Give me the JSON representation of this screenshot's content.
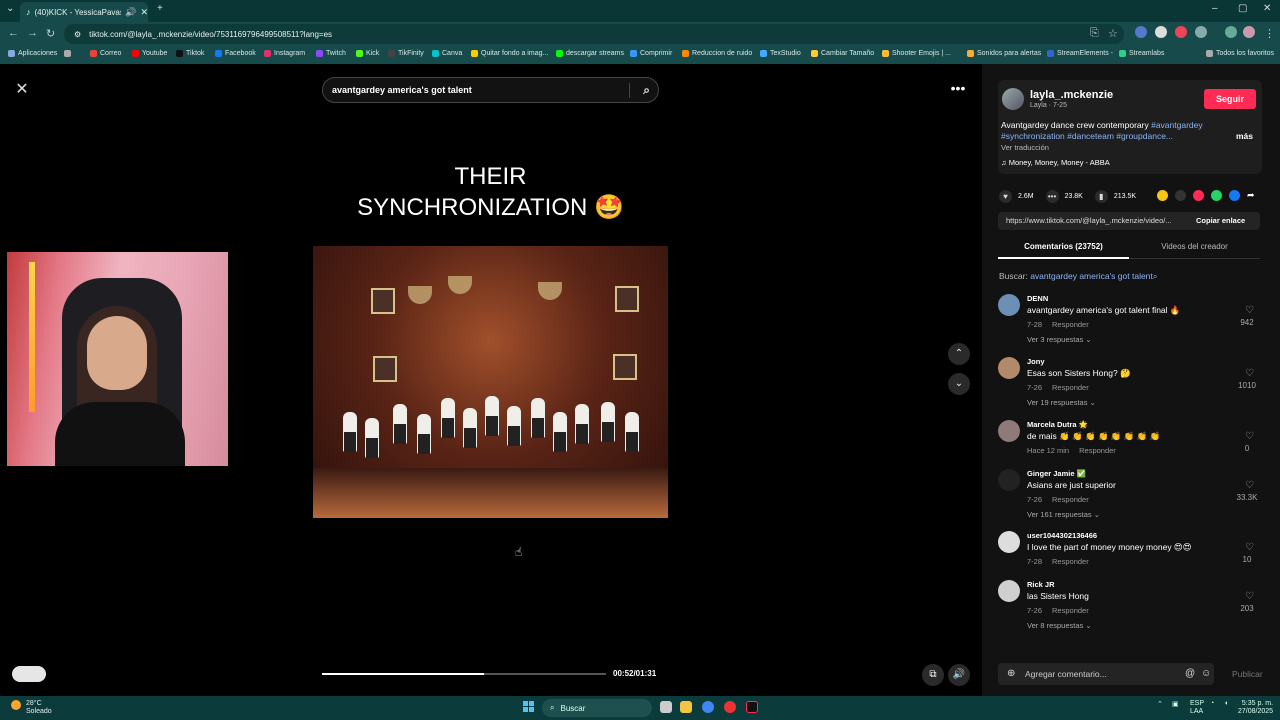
{
  "browser": {
    "tab_title": "(40)KICK - YessicaPavas",
    "url": "tiktok.com/@layla_.mckenzie/video/7531169796499508511?lang=es",
    "bookmarks": [
      "Aplicaciones",
      "Correo",
      "Youtube",
      "Tiktok",
      "Facebook",
      "Instagram",
      "Twitch",
      "Kick",
      "TikFinity",
      "Canva",
      "Quitar fondo a imag...",
      "descargar streams",
      "Comprimir",
      "Reduccion de ruido",
      "TexStudio",
      "Cambiar Tamaño",
      "Shooter Emojis | ...",
      "Sonidos para alertas",
      "StreamElements -",
      "Streamlabs",
      "Todos los favoritos"
    ]
  },
  "search": {
    "query": "avantgardey america's got talent"
  },
  "video": {
    "caption_line1": "THEIR",
    "caption_line2": "SYNCHRONIZATION 🤩",
    "time": "00:52/01:31",
    "progress": 0.57
  },
  "author": {
    "username": "layla_.mckenzie",
    "subline": "Layla · 7-25",
    "follow_label": "Seguir",
    "description_text": "Avantgardey dance crew contemporary ",
    "description_tags_1": "#avantgardey",
    "description_tags_2": "#synchronization #danceteam #groupdance...",
    "more_label": "más",
    "translate_label": "Ver traducción",
    "music": "Money, Money, Money - ABBA"
  },
  "stats": {
    "likes": "2.6M",
    "comments": "23.8K",
    "saves": "213.5K"
  },
  "link": {
    "url": "https://www.tiktok.com/@layla_.mckenzie/video/...",
    "copy_label": "Copiar enlace"
  },
  "tabs": {
    "comments": "Comentarios (23752)",
    "creator_videos": "Videos del creador"
  },
  "buscar": {
    "label": "Buscar: ",
    "query": "avantgardey america's got talent"
  },
  "comments": [
    {
      "name": "DENN",
      "text": "avantgardey america's got talent final 🔥",
      "date": "7-28",
      "reply": "Responder",
      "replies": "Ver 3 respuestas ⌄",
      "likes": "942",
      "avatar_color": "#6b8fb5"
    },
    {
      "name": "Jony",
      "text": "Esas son Sisters Hong? 🤔",
      "date": "7-26",
      "reply": "Responder",
      "replies": "Ver 19 respuestas ⌄",
      "likes": "1010",
      "avatar_color": "#b28a6a"
    },
    {
      "name": "Marcela Dutra 🌟",
      "text": "de mais 👏 👏 👏 👏 👏 👏 👏 👏",
      "date": "Hace 12 min",
      "reply": "Responder",
      "replies": "",
      "likes": "0",
      "avatar_color": "#8f7a7a"
    },
    {
      "name": "Ginger Jamie ✅",
      "text": "Asians are just superior",
      "date": "7-26",
      "reply": "Responder",
      "replies": "Ver 161 respuestas ⌄",
      "likes": "33.3K",
      "avatar_color": "#222222"
    },
    {
      "name": "user1044302136466",
      "text": "I love the part of money money money 😍😍",
      "date": "7-28",
      "reply": "Responder",
      "replies": "",
      "likes": "10",
      "avatar_color": "#dddddd"
    },
    {
      "name": "Rick JR",
      "text": "las Sisters Hong",
      "date": "7-26",
      "reply": "Responder",
      "replies": "Ver 8 respuestas ⌄",
      "likes": "203",
      "avatar_color": "#cfcfcf"
    }
  ],
  "add_comment": {
    "placeholder": "Agregar comentario...",
    "publish_label": "Publicar"
  },
  "taskbar": {
    "temp": "28°C",
    "weather": "Soleado",
    "search_label": "Buscar",
    "lang1": "ESP",
    "lang2": "LAA",
    "time": "5:35 p. m.",
    "date": "27/08/2025"
  }
}
